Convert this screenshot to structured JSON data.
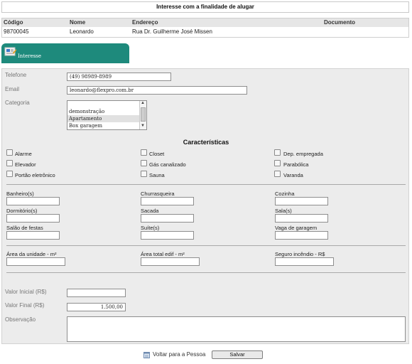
{
  "page_title": "Interesse com a finalidade de alugar",
  "client_table": {
    "headers": [
      "Código",
      "Nome",
      "Endereço",
      "Documento"
    ],
    "row": {
      "codigo": "98700045",
      "nome": "Leonardo",
      "endereco": "Rua Dr. Guilherme José Missen",
      "documento": ""
    }
  },
  "tab": {
    "label": "Interesse",
    "icon": "form-card-icon",
    "color": "#1e8a7c"
  },
  "form": {
    "telefone_label": "Telefone",
    "telefone_value": "(49) 98989-8989",
    "email_label": "Email",
    "email_value": "leonardo@flexpro.com.br",
    "categoria_label": "Categoria",
    "categoria_options": [
      "demonstração",
      "Apartamento",
      "Box garagem"
    ],
    "categoria_selected": "Apartamento"
  },
  "caracteristicas": {
    "title": "Características",
    "items": [
      {
        "label": "Alarme",
        "checked": false
      },
      {
        "label": "Closet",
        "checked": false
      },
      {
        "label": "Dep. empregada",
        "checked": false
      },
      {
        "label": "Elevador",
        "checked": false
      },
      {
        "label": "Gás canalizado",
        "checked": false
      },
      {
        "label": "Parabólica",
        "checked": false
      },
      {
        "label": "Portão eletrônico",
        "checked": false
      },
      {
        "label": "Sauna",
        "checked": false
      },
      {
        "label": "Varanda",
        "checked": false
      }
    ]
  },
  "comodos": [
    {
      "label": "Banheiro(s)",
      "value": ""
    },
    {
      "label": "Churrasqueira",
      "value": ""
    },
    {
      "label": "Cozinha",
      "value": ""
    },
    {
      "label": "Dormitório(s)",
      "value": ""
    },
    {
      "label": "Sacada",
      "value": ""
    },
    {
      "label": "Sala(s)",
      "value": ""
    },
    {
      "label": "Salão de festas",
      "value": ""
    },
    {
      "label": "Suíte(s)",
      "value": ""
    },
    {
      "label": "Vaga de garagem",
      "value": ""
    }
  ],
  "areas": [
    {
      "label": "Área da unidade - m²",
      "value": ""
    },
    {
      "label": "Área total edif - m²",
      "value": ""
    },
    {
      "label": "Seguro incêndio - R$",
      "value": ""
    }
  ],
  "valores": {
    "inicial_label": "Valor Inicial (R$)",
    "inicial_value": "",
    "final_label": "Valor Final (R$)",
    "final_value": "1.500,00",
    "observacao_label": "Observação",
    "observacao_value": ""
  },
  "actions": {
    "back_label": "Voltar para a Pessoa",
    "save_label": "Salvar"
  }
}
